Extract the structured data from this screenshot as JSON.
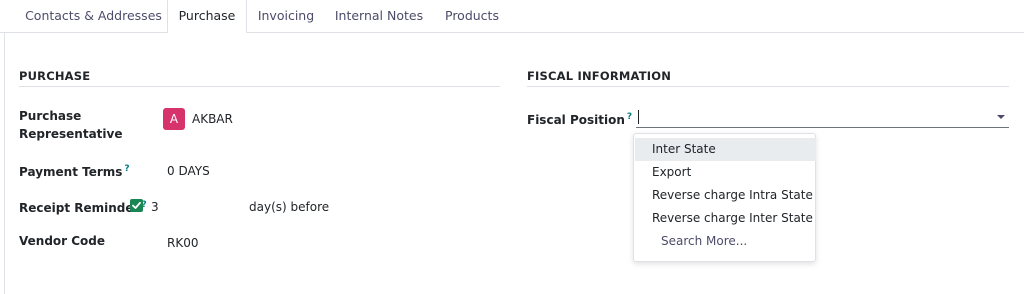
{
  "tabs": [
    {
      "label": "Contacts & Addresses"
    },
    {
      "label": "Purchase"
    },
    {
      "label": "Invoicing"
    },
    {
      "label": "Internal Notes"
    },
    {
      "label": "Products"
    }
  ],
  "active_tab": "Purchase",
  "purchase": {
    "title": "PURCHASE",
    "rep_label_line1": "Purchase",
    "rep_label_line2": "Representative",
    "rep_avatar_letter": "A",
    "rep_value": "AKBAR",
    "payment_terms_label": "Payment Terms",
    "payment_terms_value": "0 DAYS",
    "receipt_reminder_label": "Receipt Reminder",
    "receipt_reminder_checked": true,
    "receipt_reminder_days": "3",
    "receipt_reminder_suffix": "day(s) before",
    "vendor_code_label": "Vendor Code",
    "vendor_code_value": "RK00",
    "help_marker": "?"
  },
  "fiscal": {
    "title": "FISCAL INFORMATION",
    "position_label": "Fiscal Position",
    "position_value": "",
    "options": [
      {
        "label": "Inter State",
        "highlighted": true
      },
      {
        "label": "Export",
        "highlighted": false
      },
      {
        "label": "Reverse charge Intra State",
        "highlighted": false
      },
      {
        "label": "Reverse charge Inter State",
        "highlighted": false
      }
    ],
    "search_more": "Search More..."
  },
  "colors": {
    "avatar_bg": "#d6336c",
    "checkbox_bg": "#198754",
    "help_color": "#017e84"
  }
}
